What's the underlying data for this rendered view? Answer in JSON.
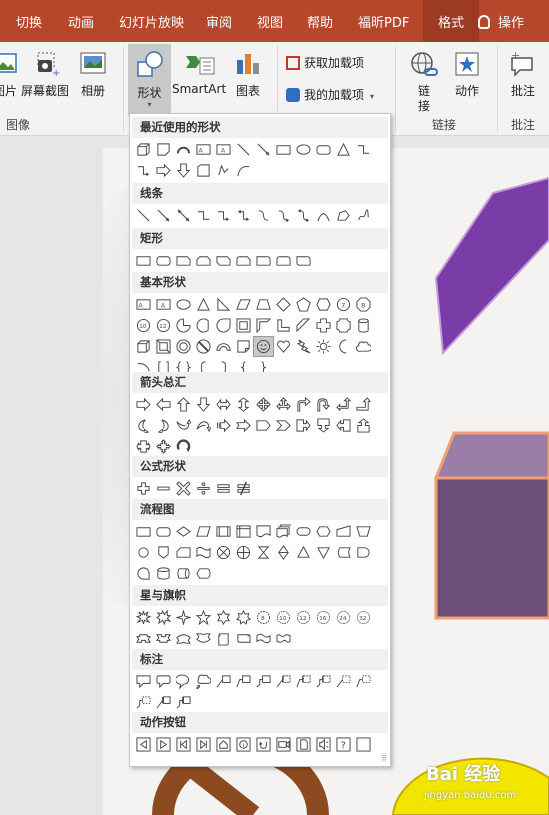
{
  "tabs": [
    "切换",
    "动画",
    "幻灯片放映",
    "审阅",
    "视图",
    "帮助",
    "福昕PDF",
    "格式"
  ],
  "tell_me": "操作",
  "ribbon": {
    "pictures_label": "图片",
    "screenshot_label": "屏幕截图",
    "album_label": "相册",
    "images_group_label": "图像",
    "shapes_label": "形状",
    "smartart_label": "SmartArt",
    "chart_label": "图表",
    "get_addins_label": "获取加载项",
    "my_addins_label": "我的加载项",
    "link_label": "链接",
    "action_label": "动作",
    "links_group_label": "链接",
    "comment_label": "批注",
    "comments_group_label": "批注"
  },
  "shapes_panel": {
    "sections": [
      {
        "title": "最近使用的形状"
      },
      {
        "title": "线条"
      },
      {
        "title": "矩形"
      },
      {
        "title": "基本形状"
      },
      {
        "title": "箭头总汇"
      },
      {
        "title": "公式形状"
      },
      {
        "title": "流程图"
      },
      {
        "title": "星与旗帜"
      },
      {
        "title": "标注"
      },
      {
        "title": "动作按钮"
      }
    ]
  },
  "watermark": {
    "main": "Bai 经验",
    "sub": "jingyan.baidu.com"
  },
  "colors": {
    "accent": "#b7472a",
    "active_tab": "#9c3a22",
    "purple_shape": "#7a3da8",
    "box": "#6b4f7a",
    "orange_edge": "#f0a070"
  }
}
